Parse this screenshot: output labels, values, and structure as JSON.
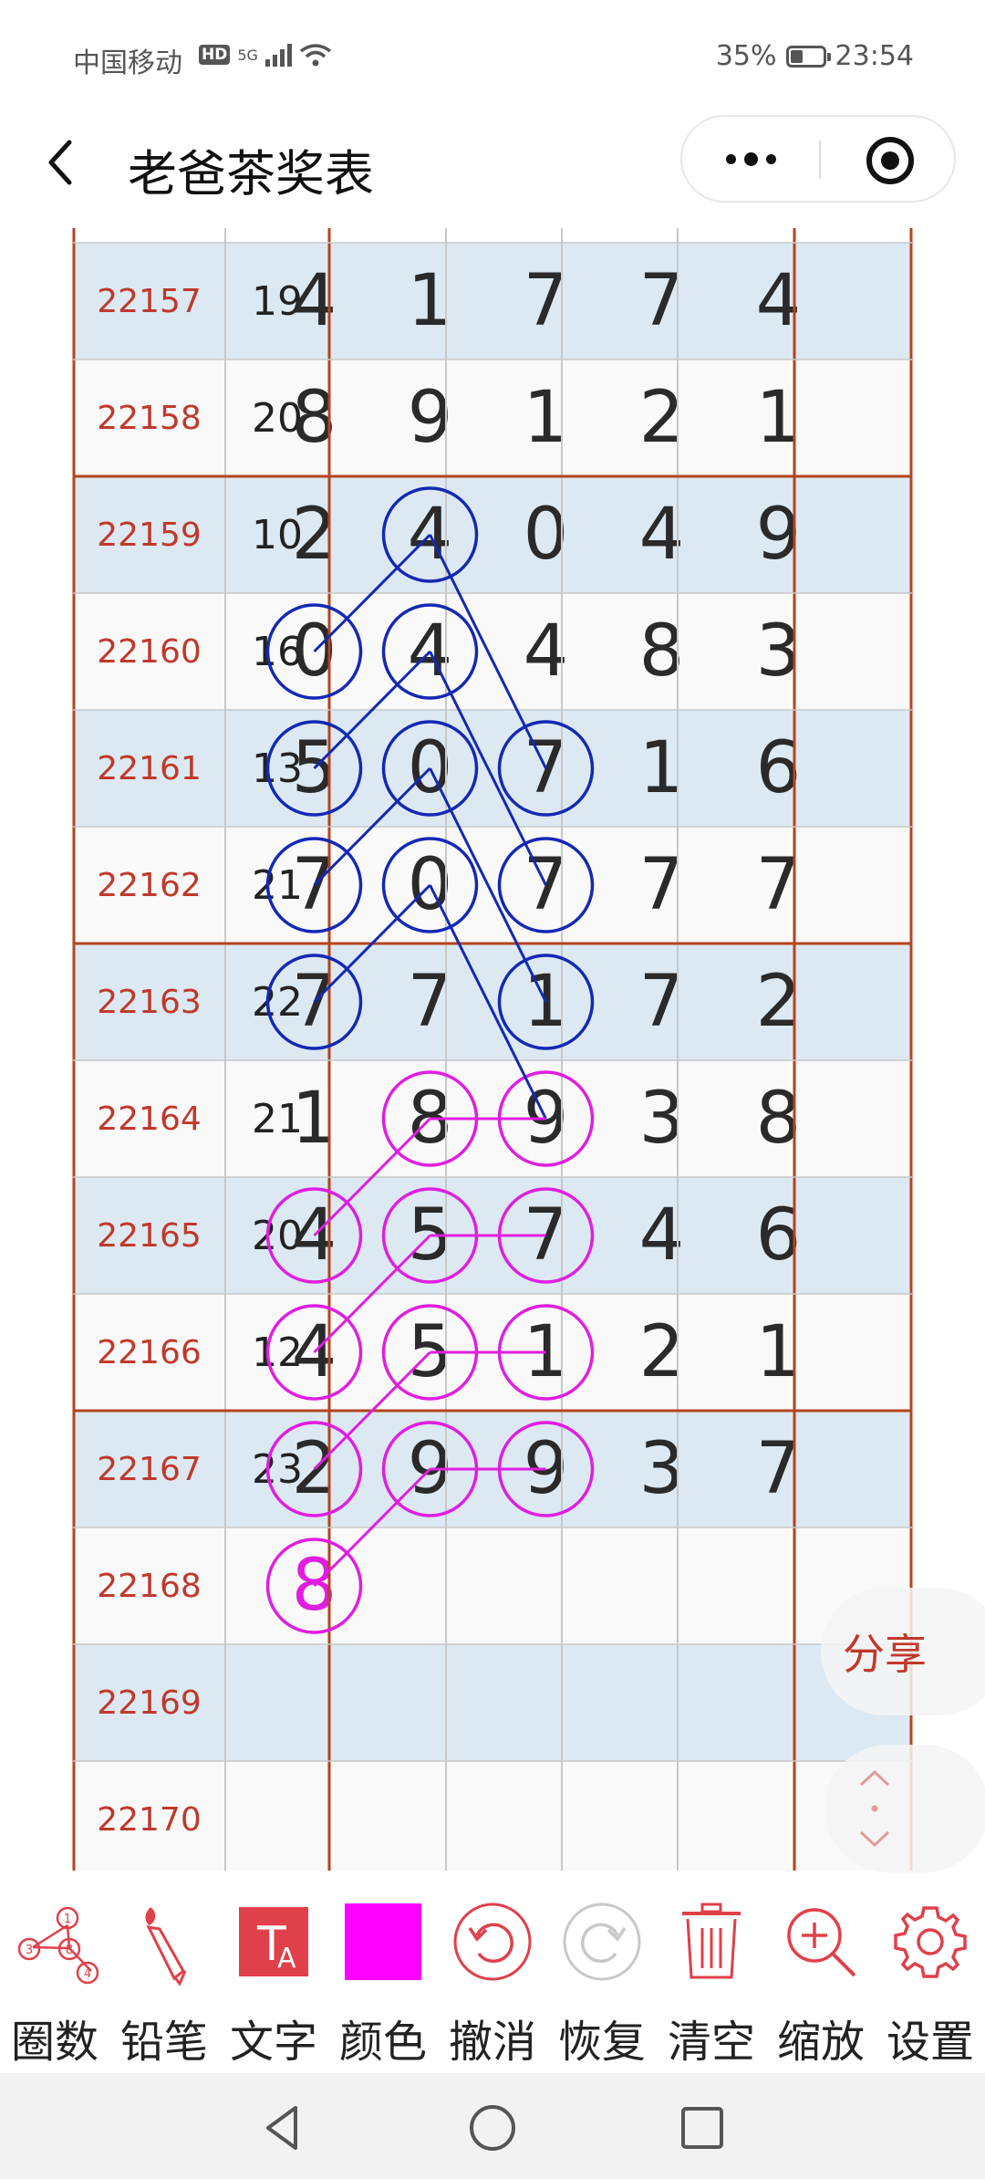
{
  "status_bar": {
    "carrier": "中国移动",
    "hd": "HD",
    "network": "5G",
    "battery": "35%",
    "battery_level": 0.35,
    "time": "23:54"
  },
  "title_bar": {
    "title": "老爸茶奖表"
  },
  "table": {
    "rows": [
      {
        "issue": "22157",
        "sum": "19",
        "digits": [
          "4",
          "1",
          "7",
          "7",
          "4"
        ]
      },
      {
        "issue": "22158",
        "sum": "20",
        "digits": [
          "8",
          "9",
          "1",
          "2",
          "1"
        ]
      },
      {
        "issue": "22159",
        "sum": "10",
        "digits": [
          "2",
          "4",
          "0",
          "4",
          "9"
        ]
      },
      {
        "issue": "22160",
        "sum": "16",
        "digits": [
          "0",
          "4",
          "4",
          "8",
          "3"
        ]
      },
      {
        "issue": "22161",
        "sum": "13",
        "digits": [
          "5",
          "0",
          "7",
          "1",
          "6"
        ]
      },
      {
        "issue": "22162",
        "sum": "21",
        "digits": [
          "7",
          "0",
          "7",
          "7",
          "7"
        ]
      },
      {
        "issue": "22163",
        "sum": "22",
        "digits": [
          "7",
          "7",
          "1",
          "7",
          "2"
        ]
      },
      {
        "issue": "22164",
        "sum": "21",
        "digits": [
          "1",
          "8",
          "9",
          "3",
          "8"
        ]
      },
      {
        "issue": "22165",
        "sum": "20",
        "digits": [
          "4",
          "5",
          "7",
          "4",
          "6"
        ]
      },
      {
        "issue": "22166",
        "sum": "12",
        "digits": [
          "4",
          "5",
          "1",
          "2",
          "1"
        ]
      },
      {
        "issue": "22167",
        "sum": "23",
        "digits": [
          "2",
          "9",
          "9",
          "3",
          "7"
        ]
      },
      {
        "issue": "22168",
        "sum": "",
        "digits": [
          "8",
          "",
          "",
          "",
          ""
        ]
      },
      {
        "issue": "22169",
        "sum": "",
        "digits": [
          "",
          "",
          "",
          "",
          ""
        ]
      },
      {
        "issue": "22170",
        "sum": "",
        "digits": [
          "",
          "",
          "",
          "",
          ""
        ]
      }
    ],
    "circled_blue": [
      [
        2,
        1
      ],
      [
        3,
        0
      ],
      [
        3,
        1
      ],
      [
        4,
        0
      ],
      [
        4,
        1
      ],
      [
        4,
        2
      ],
      [
        5,
        0
      ],
      [
        5,
        1
      ],
      [
        5,
        2
      ],
      [
        6,
        0
      ],
      [
        6,
        2
      ]
    ],
    "circled_magenta": [
      [
        7,
        1
      ],
      [
        7,
        2
      ],
      [
        8,
        0
      ],
      [
        8,
        1
      ],
      [
        8,
        2
      ],
      [
        9,
        0
      ],
      [
        9,
        1
      ],
      [
        9,
        2
      ],
      [
        10,
        0
      ],
      [
        10,
        1
      ],
      [
        10,
        2
      ],
      [
        11,
        0
      ]
    ],
    "magenta_entry": {
      "row": 11,
      "col": 0
    }
  },
  "floating": {
    "share_label": "分享"
  },
  "toolbar": {
    "tools": [
      {
        "id": "circle-numbers",
        "label": "圈数"
      },
      {
        "id": "pencil",
        "label": "铅笔"
      },
      {
        "id": "text",
        "label": "文字"
      },
      {
        "id": "color",
        "label": "颜色"
      },
      {
        "id": "undo",
        "label": "撤消"
      },
      {
        "id": "redo",
        "label": "恢复"
      },
      {
        "id": "clear",
        "label": "清空"
      },
      {
        "id": "zoom",
        "label": "缩放"
      },
      {
        "id": "settings",
        "label": "设置"
      }
    ]
  },
  "colors": {
    "issue_text": "#c0392b",
    "row_blue": "#dce9f2",
    "row_white": "#f9f9f9",
    "grid_brown": "#b5441d",
    "grid_gray": "#c8c8c8",
    "circle_blue": "#1428b4",
    "circle_magenta": "#e01ee0",
    "accent_red": "#e0404a",
    "selected_color": "#ff00ff"
  }
}
